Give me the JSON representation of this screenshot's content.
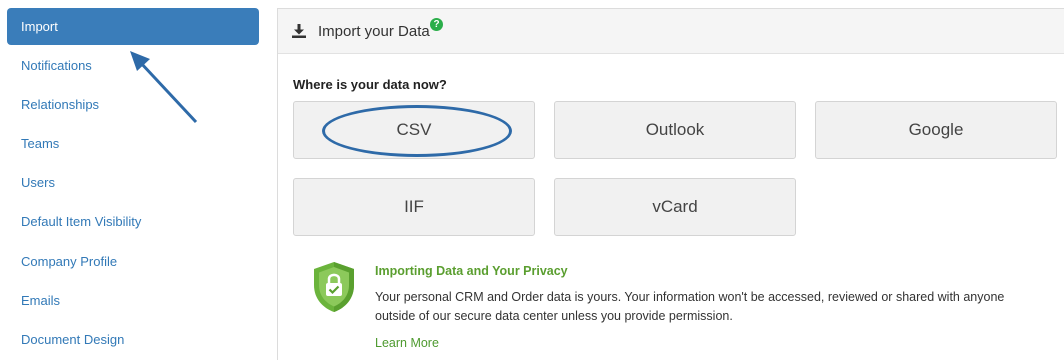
{
  "sidebar": {
    "items": [
      {
        "label": "Import",
        "active": true
      },
      {
        "label": "Notifications"
      },
      {
        "label": "Relationships"
      },
      {
        "label": "Teams"
      },
      {
        "label": "Users"
      },
      {
        "label": "Default Item Visibility"
      },
      {
        "label": "Company Profile"
      },
      {
        "label": "Emails"
      },
      {
        "label": "Document Design"
      }
    ]
  },
  "header": {
    "title": "Import your Data",
    "icon": "download-icon",
    "help_icon": "help-icon",
    "help_symbol": "?"
  },
  "main": {
    "question": "Where is your data now?",
    "sources": [
      "CSV",
      "Outlook",
      "Google",
      "IIF",
      "vCard"
    ]
  },
  "privacy": {
    "icon": "shield-check-icon",
    "title": "Importing Data and Your Privacy",
    "text": "Your personal CRM and Order data is yours. Your information won't be accessed, reviewed or shared with anyone outside of our secure data center unless you provide permission.",
    "link": "Learn More"
  },
  "colors": {
    "accent": "#3a7dba",
    "link": "#3279b7",
    "annotation": "#2e6aa8",
    "privacy_green": "#5a9e2f",
    "help_green": "#2bae4a"
  }
}
